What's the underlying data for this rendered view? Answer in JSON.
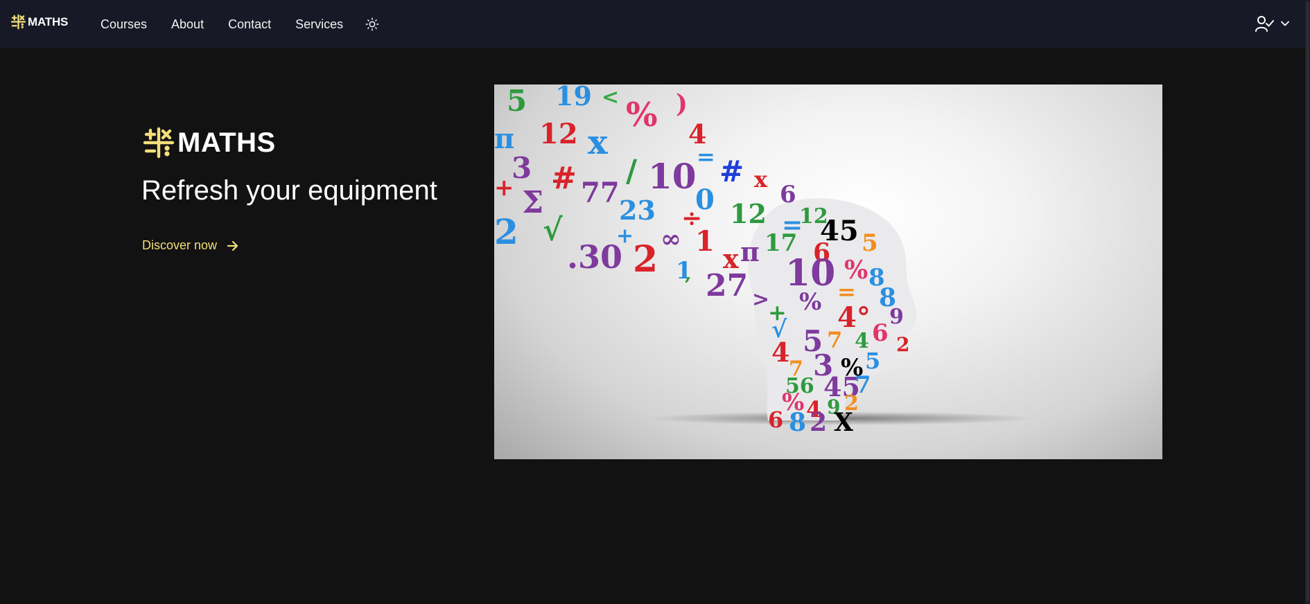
{
  "nav": {
    "brand": "MATHS",
    "links": [
      {
        "label": "Courses"
      },
      {
        "label": "About"
      },
      {
        "label": "Contact"
      },
      {
        "label": "Services"
      }
    ],
    "theme_icon": "sun-icon",
    "user_icon": "user-check-icon",
    "user_chevron": "chevron-down-icon"
  },
  "hero": {
    "logo_text": "MATHS",
    "heading": "Refresh your equipment",
    "cta_label": "Discover now",
    "cta_icon": "arrow-right-icon",
    "image_alt": "head made of colorful numbers and math symbols"
  },
  "colors": {
    "accent": "#f4df7a",
    "background": "#121212",
    "navbar": "#171a26"
  }
}
